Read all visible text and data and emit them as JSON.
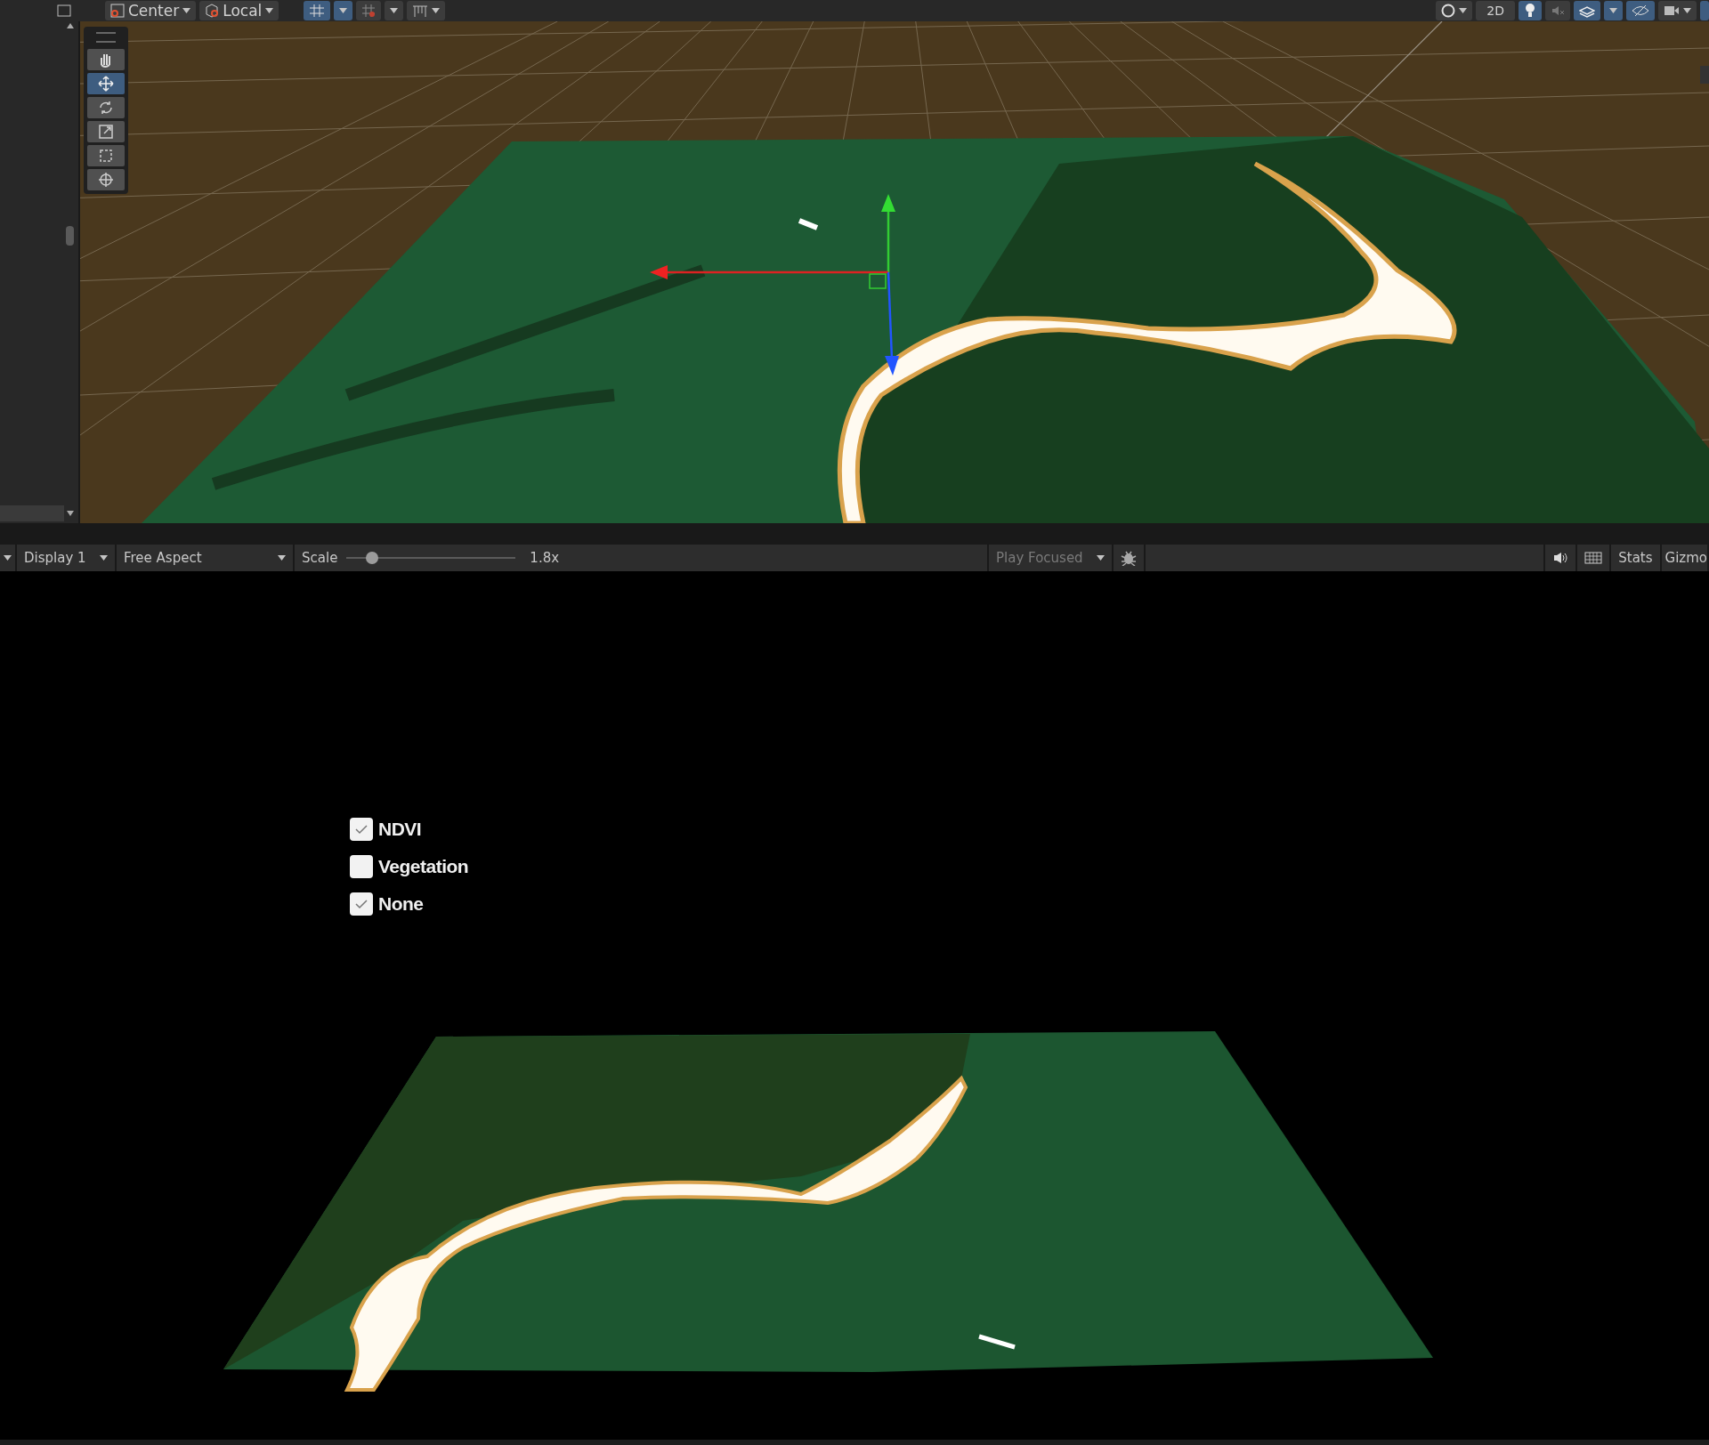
{
  "scene_toolbar": {
    "pivot": "Center",
    "handle": "Local",
    "mode_2d": {
      "label": "2D",
      "selected": false
    },
    "lighting": {
      "selected": true
    },
    "grid_snap": {
      "selected": true
    },
    "effects": {
      "selected": true
    },
    "visibility": {
      "selected": true
    }
  },
  "tool_palette": [
    {
      "selected": false
    },
    {
      "selected": true
    },
    {
      "selected": false
    },
    {
      "selected": false
    },
    {
      "selected": false
    },
    {
      "selected": false
    }
  ],
  "game_toolbar": {
    "display": "Display 1",
    "aspect": "Free Aspect",
    "scale_label": "Scale",
    "scale": {
      "level": 0.15
    },
    "scale_reading": "1.8x",
    "play_mode": "Play Focused",
    "stats": "Stats",
    "gizmos": "Gizmo"
  },
  "overlay_toggles": [
    {
      "label": "NDVI",
      "checked": true
    },
    {
      "label": "Vegetation",
      "checked": false
    },
    {
      "label": "None",
      "checked": true
    }
  ]
}
